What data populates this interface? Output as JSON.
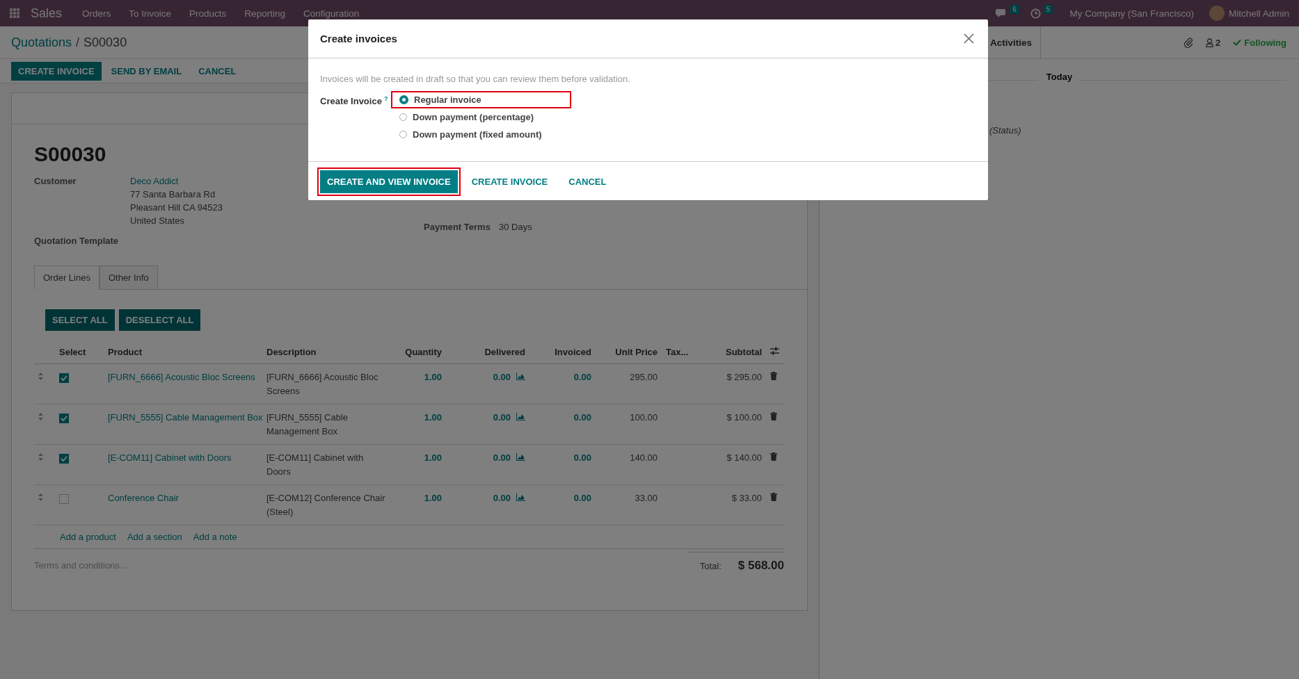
{
  "navbar": {
    "app": "Sales",
    "menu": [
      "Orders",
      "To Invoice",
      "Products",
      "Reporting",
      "Configuration"
    ],
    "messages_count": "6",
    "activities_count": "5",
    "company": "My Company (San Francisco)",
    "user": "Mitchell Admin"
  },
  "breadcrumb": {
    "parent": "Quotations",
    "separator": "/",
    "current": "S00030"
  },
  "actions": [
    {
      "label": "CREATE INVOICE",
      "primary": true
    },
    {
      "label": "SEND BY EMAIL",
      "primary": false
    },
    {
      "label": "CANCEL",
      "primary": false
    }
  ],
  "chatter": {
    "activities": "Activities",
    "followers": "2",
    "following": "Following",
    "date_separator": "Today",
    "message_text": "(Status)"
  },
  "sheet": {
    "name": "S00030",
    "customer_label": "Customer",
    "customer": "Deco Addict",
    "address": [
      "77 Santa Barbara Rd",
      "Pleasant Hill CA 94523",
      "United States"
    ],
    "template_label": "Quotation Template",
    "payment_terms_label": "Payment Terms",
    "payment_terms": "30 Days"
  },
  "tabs": [
    {
      "label": "Order Lines",
      "selected": true
    },
    {
      "label": "Other Info",
      "selected": false
    }
  ],
  "line_buttons": [
    "SELECT ALL",
    "DESELECT ALL"
  ],
  "table": {
    "columns": [
      "Select",
      "Product",
      "Description",
      "Quantity",
      "Delivered",
      "Invoiced",
      "Unit Price",
      "Tax...",
      "Subtotal"
    ],
    "rows": [
      {
        "checked": true,
        "product": "[FURN_6666] Acoustic Bloc Screens",
        "description": "[FURN_6666] Acoustic Bloc Screens",
        "quantity": "1.00",
        "delivered": "0.00",
        "invoiced": "0.00",
        "unit_price": "295.00",
        "subtotal": "$ 295.00"
      },
      {
        "checked": true,
        "product": "[FURN_5555] Cable Management Box",
        "description": "[FURN_5555] Cable Management Box",
        "quantity": "1.00",
        "delivered": "0.00",
        "invoiced": "0.00",
        "unit_price": "100.00",
        "subtotal": "$ 100.00"
      },
      {
        "checked": true,
        "product": "[E-COM11] Cabinet with Doors",
        "description": "[E-COM11] Cabinet with Doors",
        "quantity": "1.00",
        "delivered": "0.00",
        "invoiced": "0.00",
        "unit_price": "140.00",
        "subtotal": "$ 140.00"
      },
      {
        "checked": false,
        "product": "Conference Chair",
        "description": "[E-COM12] Conference Chair (Steel)",
        "quantity": "1.00",
        "delivered": "0.00",
        "invoiced": "0.00",
        "unit_price": "33.00",
        "subtotal": "$ 33.00"
      }
    ]
  },
  "add_links": [
    "Add a product",
    "Add a section",
    "Add a note"
  ],
  "terms_placeholder": "Terms and conditions...",
  "total": {
    "label": "Total:",
    "value": "$ 568.00"
  },
  "dialog": {
    "title": "Create invoices",
    "hint": "Invoices will be created in draft so that you can review them before validation.",
    "field_label": "Create Invoice",
    "help_mark": "?",
    "options": [
      {
        "label": "Regular invoice",
        "selected": true,
        "highlighted": true
      },
      {
        "label": "Down payment (percentage)",
        "selected": false,
        "highlighted": false
      },
      {
        "label": "Down payment (fixed amount)",
        "selected": false,
        "highlighted": false
      }
    ],
    "buttons": [
      {
        "label": "CREATE AND VIEW INVOICE",
        "primary": true,
        "highlighted": true
      },
      {
        "label": "CREATE INVOICE",
        "primary": false,
        "highlighted": false
      },
      {
        "label": "CANCEL",
        "primary": false,
        "highlighted": false
      }
    ]
  }
}
